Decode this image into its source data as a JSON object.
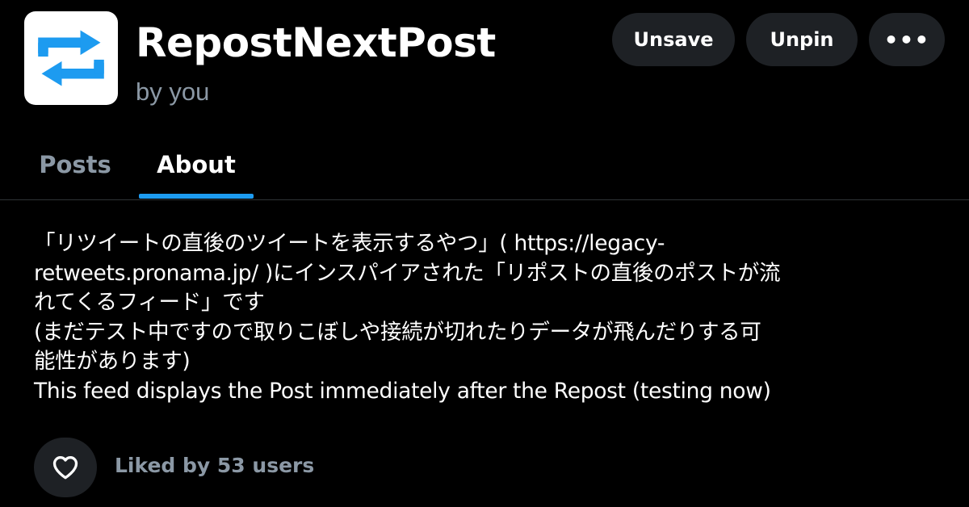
{
  "feed": {
    "title": "RepostNextPost",
    "author": "by you",
    "avatar_icon": "repost-arrows-icon",
    "avatar_color": "#1d9bf0"
  },
  "actions": {
    "unsave_label": "Unsave",
    "unpin_label": "Unpin",
    "more_label": "•••"
  },
  "tabs": [
    {
      "label": "Posts",
      "active": false
    },
    {
      "label": "About",
      "active": true
    }
  ],
  "description": {
    "lines": [
      "「リツイートの直後のツイートを表示するやつ」( https://legacy-",
      "retweets.pronama.jp/ )にインスパイアされた「リポストの直後のポストが流",
      "れてくるフィード」です",
      "(まだテスト中ですので取りこぼしや接続が切れたりデータが飛んだりする可",
      "能性があります)",
      "This feed displays the Post immediately after the Repost (testing now)"
    ]
  },
  "likes": {
    "icon": "heart-icon",
    "text": "Liked by 53 users"
  },
  "colors": {
    "background": "#000000",
    "accent": "#1d9bf0",
    "muted_text": "#8b98a5",
    "button_bg": "#1e2125"
  }
}
